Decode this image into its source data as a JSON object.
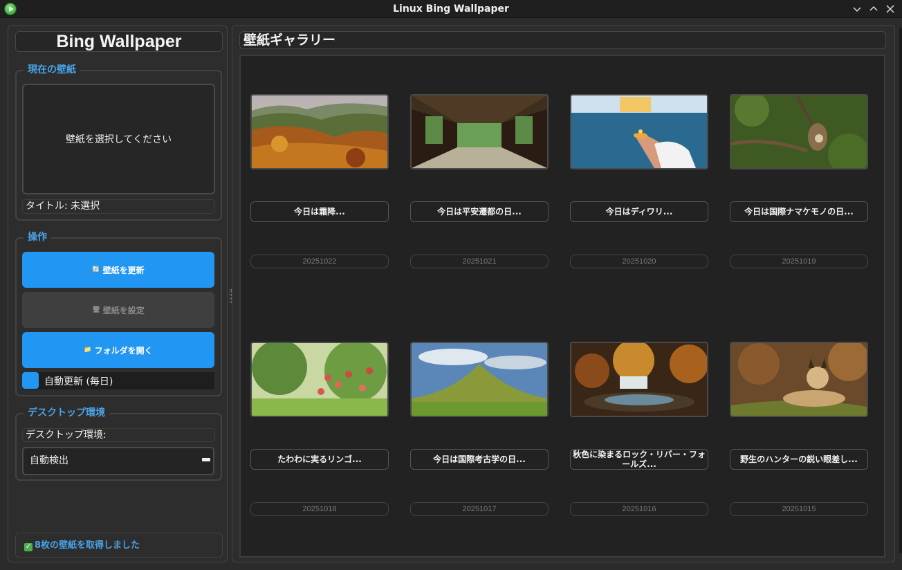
{
  "window": {
    "title": "Linux Bing Wallpaper",
    "controls": [
      "chevron-down-icon",
      "chevron-up-icon",
      "close-icon"
    ]
  },
  "sidebar": {
    "app_title": "Bing Wallpaper",
    "current": {
      "group_title": "現在の壁紙",
      "placeholder": "壁紙を選択してください",
      "title_label": "タイトル: 未選択"
    },
    "actions": {
      "group_title": "操作",
      "refresh_icon": "🔄",
      "refresh_label": "壁紙を更新",
      "set_icon": "🖥",
      "set_label": "壁紙を設定",
      "folder_icon": "📁",
      "folder_label": "フォルダを開く",
      "auto_update_label": "自動更新 (毎日)",
      "auto_update_checked": true
    },
    "desktop": {
      "group_title": "デスクトップ環境",
      "label": "デスクトップ環境:",
      "selected": "自動検出"
    },
    "status": "8枚の壁紙を取得しました"
  },
  "gallery": {
    "heading": "壁紙ギャラリー",
    "items": [
      {
        "title": "今日は霜降...",
        "date": "20251022",
        "thumb": "autumn-hills"
      },
      {
        "title": "今日は平安遷都の日...",
        "date": "20251021",
        "thumb": "wooden-corridor"
      },
      {
        "title": "今日はディワリ...",
        "date": "20251020",
        "thumb": "diwali-lamp"
      },
      {
        "title": "今日は国際ナマケモノの日...",
        "date": "20251019",
        "thumb": "sloth"
      },
      {
        "title": "たわわに実るリンゴ...",
        "date": "20251018",
        "thumb": "apple-tree"
      },
      {
        "title": "今日は国際考古学の日...",
        "date": "20251017",
        "thumb": "grass-mound"
      },
      {
        "title": "秋色に染まるロック・リバー・フォールズ...",
        "date": "20251016",
        "thumb": "waterfall"
      },
      {
        "title": "野生のハンターの鋭い眼差し...",
        "date": "20251015",
        "thumb": "lynx"
      }
    ]
  },
  "colors": {
    "accent": "#2196f3",
    "group_title": "#4aa3e8",
    "background": "#2b2b2b"
  }
}
